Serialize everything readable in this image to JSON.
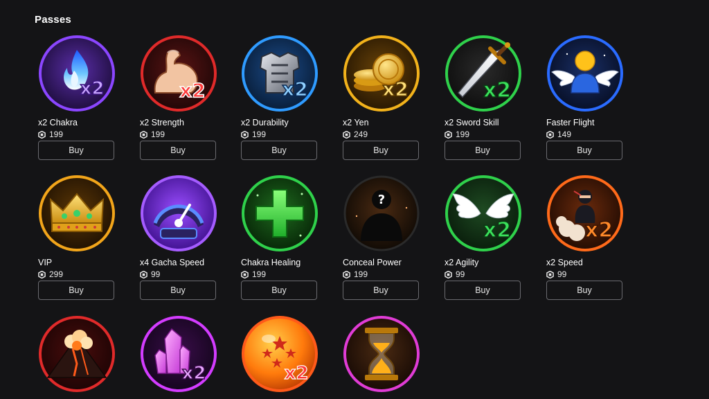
{
  "section": {
    "title": "Passes"
  },
  "passes": [
    {
      "name": "x2 Chakra",
      "price": "199",
      "buy_label": "Buy",
      "icon": "blue-flame-icon",
      "ring": "#7a3cff"
    },
    {
      "name": "x2 Strength",
      "price": "199",
      "buy_label": "Buy",
      "icon": "flexed-arm-icon",
      "ring": "#e02a2a"
    },
    {
      "name": "x2 Durability",
      "price": "199",
      "buy_label": "Buy",
      "icon": "chest-armor-icon",
      "ring": "#2f9bff"
    },
    {
      "name": "x2 Yen",
      "price": "249",
      "buy_label": "Buy",
      "icon": "gold-coins-icon",
      "ring": "#f2b21b"
    },
    {
      "name": "x2 Sword Skill",
      "price": "199",
      "buy_label": "Buy",
      "icon": "sword-icon",
      "ring": "#2fd14b"
    },
    {
      "name": "Faster Flight",
      "price": "149",
      "buy_label": "Buy",
      "icon": "winged-avatar-icon",
      "ring": "#2a6bff"
    },
    {
      "name": "VIP",
      "price": "299",
      "buy_label": "Buy",
      "icon": "crown-icon",
      "ring": "#f2a51a"
    },
    {
      "name": "x4 Gacha Speed",
      "price": "99",
      "buy_label": "Buy",
      "icon": "speedometer-icon",
      "ring": "#8a3cff"
    },
    {
      "name": "Chakra Healing",
      "price": "199",
      "buy_label": "Buy",
      "icon": "green-cross-icon",
      "ring": "#2fd14b"
    },
    {
      "name": "Conceal Power",
      "price": "199",
      "buy_label": "Buy",
      "icon": "hidden-figure-icon",
      "ring": "#2a2a2a"
    },
    {
      "name": "x2 Agility",
      "price": "99",
      "buy_label": "Buy",
      "icon": "wings-icon",
      "ring": "#2fd14b"
    },
    {
      "name": "x2 Speed",
      "price": "99",
      "buy_label": "Buy",
      "icon": "running-ninja-icon",
      "ring": "#ff6a1a"
    },
    {
      "name": "",
      "price": "",
      "buy_label": "",
      "icon": "volcano-icon",
      "ring": "#e02a2a"
    },
    {
      "name": "",
      "price": "",
      "buy_label": "",
      "icon": "crystal-icon",
      "ring": "#d33cff"
    },
    {
      "name": "",
      "price": "",
      "buy_label": "",
      "icon": "dragon-ball-icon",
      "ring": "#ff6a1a"
    },
    {
      "name": "",
      "price": "",
      "buy_label": "",
      "icon": "hourglass-icon",
      "ring": "#e03cd6"
    }
  ],
  "badge": {
    "x2": "x2"
  }
}
